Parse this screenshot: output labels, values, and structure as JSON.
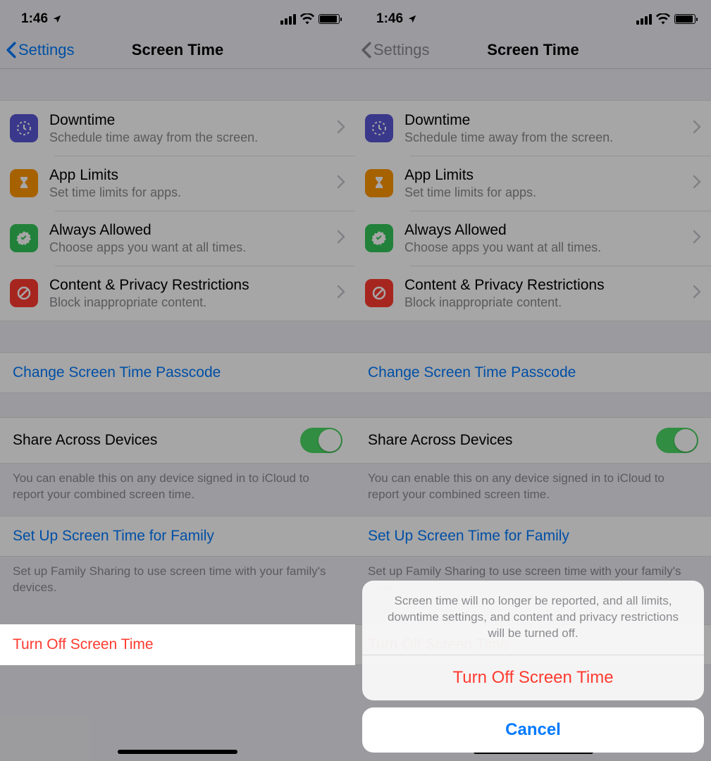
{
  "statusBar": {
    "time": "1:46"
  },
  "nav": {
    "back": "Settings",
    "title": "Screen Time"
  },
  "options": {
    "downtime": {
      "title": "Downtime",
      "subtitle": "Schedule time away from the screen."
    },
    "appLimits": {
      "title": "App Limits",
      "subtitle": "Set time limits for apps."
    },
    "always": {
      "title": "Always Allowed",
      "subtitle": "Choose apps you want at all times."
    },
    "content": {
      "title": "Content & Privacy Restrictions",
      "subtitle": "Block inappropriate content."
    }
  },
  "changePasscode": "Change Screen Time Passcode",
  "shareAcross": {
    "label": "Share Across Devices",
    "enabled": true,
    "footer": "You can enable this on any device signed in to iCloud to report your combined screen time."
  },
  "family": {
    "label": "Set Up Screen Time for Family",
    "footer": "Set up Family Sharing to use screen time with your family's devices."
  },
  "turnOff": "Turn Off Screen Time",
  "actionSheet": {
    "message": "Screen time will no longer be reported, and all limits, downtime settings, and content and privacy restrictions will be turned off.",
    "confirm": "Turn Off Screen Time",
    "cancel": "Cancel"
  }
}
